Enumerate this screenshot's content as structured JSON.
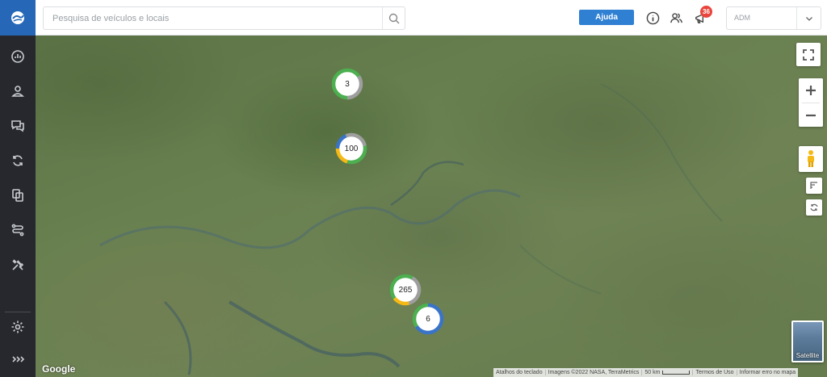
{
  "search": {
    "placeholder": "Pesquisa de veículos e locais"
  },
  "header": {
    "help_label": "Ajuda",
    "notification_count": "36",
    "user_value": "ADM"
  },
  "sidebar": {
    "items": [
      {
        "icon": "dashboard-gauge-icon"
      },
      {
        "icon": "user-icon"
      },
      {
        "icon": "chat-icon"
      },
      {
        "icon": "sync-icon"
      },
      {
        "icon": "documents-icon"
      },
      {
        "icon": "route-icon"
      },
      {
        "icon": "tools-icon"
      },
      {
        "icon": "settings-gear-icon"
      },
      {
        "icon": "expand-chevrons-icon"
      }
    ]
  },
  "map": {
    "clusters": [
      {
        "count": "3"
      },
      {
        "count": "100"
      },
      {
        "count": "265"
      },
      {
        "count": "6"
      }
    ],
    "google_logo": "Google",
    "attribution": {
      "shortcuts": "Atalhos do teclado",
      "imagery": "Imagens ©2022 NASA, TerraMetrics",
      "scale": "50 km",
      "terms": "Termos de Uso",
      "report": "Informar erro no mapa"
    },
    "layer_label": "Satellite"
  },
  "colors": {
    "sidebar_bg": "#26282d",
    "logo_bg": "#2767b8",
    "accent_blue": "#2f7fd3",
    "badge_red": "#e8453c",
    "cluster_green": "#4caf50",
    "cluster_yellow": "#f5b915",
    "cluster_blue": "#3a74c8",
    "cluster_gray": "#9e9e9e"
  }
}
